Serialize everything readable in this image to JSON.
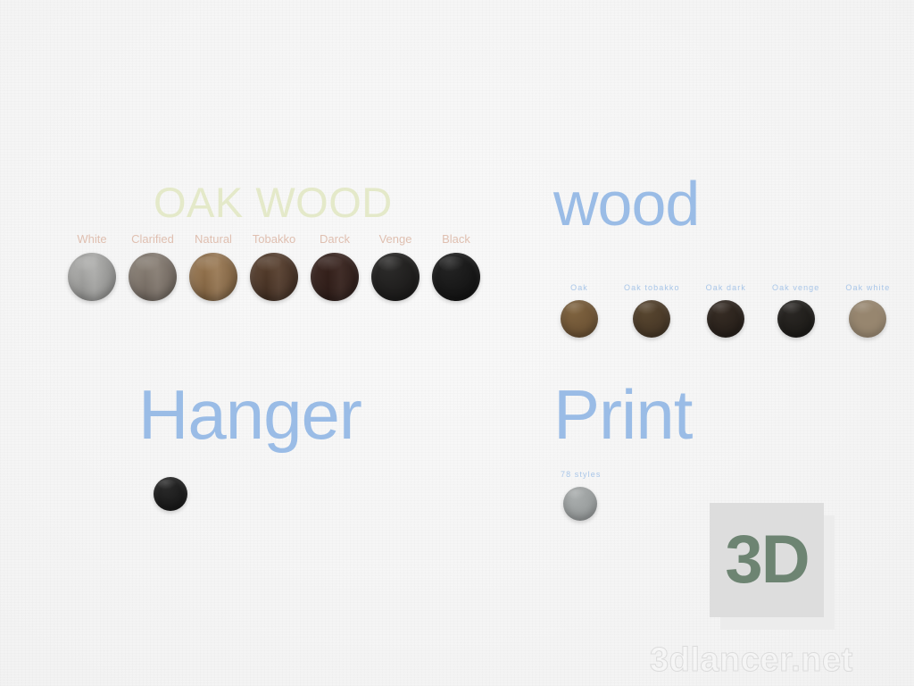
{
  "background": {
    "color": "#f5f5f5"
  },
  "palette": {
    "heading_green": "#e4e9c9",
    "heading_blue": "#9abce6",
    "label_pink": "#dfbfb0",
    "label_blue": "#a9c6e8",
    "logo_green": "#6d8472",
    "logo_square": "#dddddd",
    "logo_square_back": "#ececec"
  },
  "sections": {
    "oak_wood": {
      "heading": "OAK WOOD",
      "swatches": [
        {
          "label": "White",
          "color": "#9b9b99"
        },
        {
          "label": "Clarified",
          "color": "#7a7067"
        },
        {
          "label": "Natural",
          "color": "#8a6a46"
        },
        {
          "label": "Tobakko",
          "color": "#4b3527"
        },
        {
          "label": "Darck",
          "color": "#33201b"
        },
        {
          "label": "Venge",
          "color": "#1f1e1d"
        },
        {
          "label": "Black",
          "color": "#171717"
        }
      ]
    },
    "wood": {
      "heading": "wood",
      "swatches": [
        {
          "label": "Oak",
          "color": "#6f5536"
        },
        {
          "label": "Oak tobakko",
          "color": "#4a3a28"
        },
        {
          "label": "Oak dark",
          "color": "#2a221c"
        },
        {
          "label": "Oak venge",
          "color": "#201e1b"
        },
        {
          "label": "Oak white",
          "color": "#97866f"
        }
      ]
    },
    "hanger": {
      "heading": "Hanger",
      "swatches": [
        {
          "label": "",
          "color": "#1c1c1c"
        }
      ]
    },
    "print": {
      "heading": "Print",
      "swatches": [
        {
          "label": "78 styles",
          "color": "#9a9e9e"
        }
      ]
    }
  },
  "branding": {
    "logo_text": "3D",
    "watermark_text": "3dlancer.net"
  }
}
